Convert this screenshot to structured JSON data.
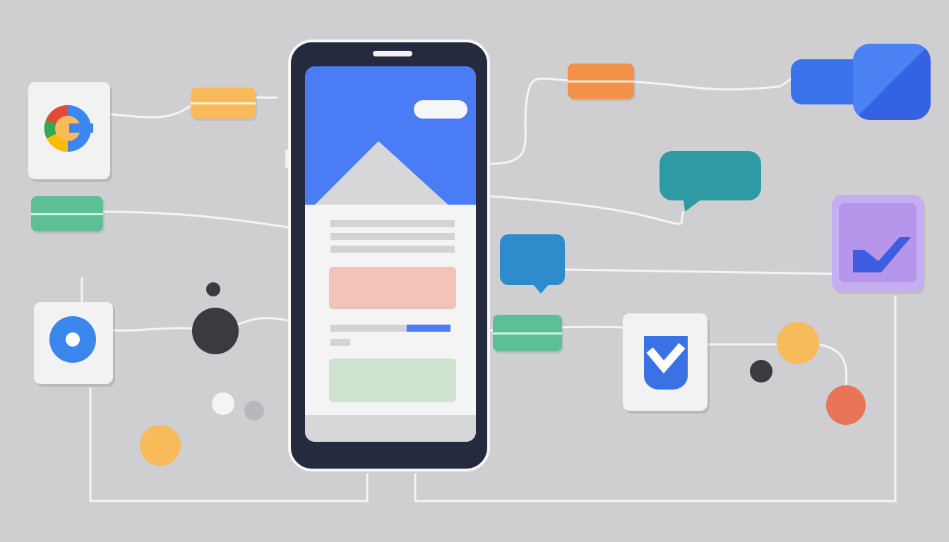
{
  "scene": "illustration",
  "colors": {
    "background": "#cfcfd1",
    "phone_frame": "#262a3e",
    "screen_blue": "#4a7df5",
    "card": "#f4f4f5",
    "accent_red": "#f2c4b8",
    "accent_green": "#cfe3d0",
    "orange": "#f2914a",
    "yellow": "#f8ba5a",
    "green": "#5cbf95",
    "teal": "#2e9aa3",
    "blue_bubble": "#2f8ccc",
    "purple": "#b596ea",
    "red": "#e8745a",
    "dark": "#3a3b40"
  },
  "icons": {
    "google": "google-logo-icon",
    "location": "location-dot-icon",
    "chat": "chat-bubble-icon",
    "check": "checkmark-icon",
    "shield_check": "shield-check-icon",
    "chevron": "chevron-icon"
  }
}
